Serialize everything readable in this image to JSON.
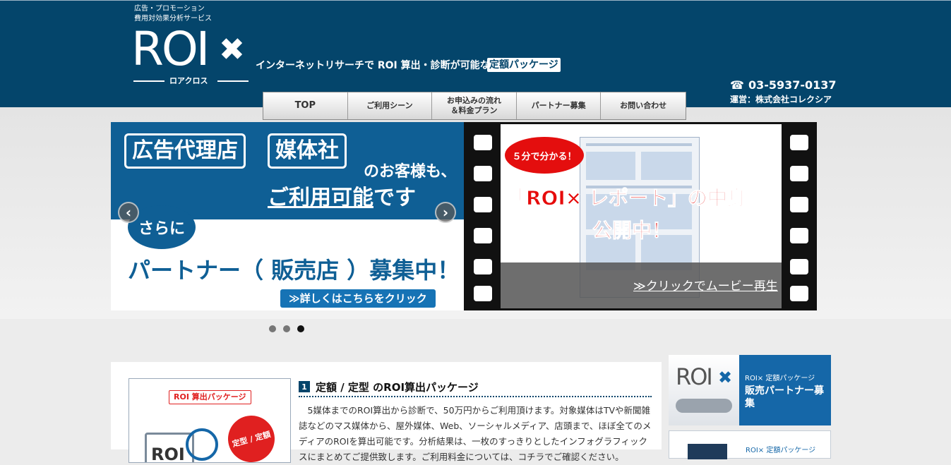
{
  "header": {
    "tagline_line1": "広告・プロモーション",
    "tagline_line2": "費用対効果分析サービス",
    "logo_text": "ROI",
    "logo_x": "✖",
    "logo_sub": "ロアクロス",
    "catchphrase": "インターネットリサーチで ROI 算出・診断が可能な",
    "package_tag": "定額パッケージ",
    "tel_icon": "☎",
    "tel": "03-5937-0137",
    "operator": "運営：株式会社コレクシア"
  },
  "nav": {
    "items": [
      {
        "label": "TOP"
      },
      {
        "label": "ご利用シーン"
      },
      {
        "label": "お申込みの流れ\n＆料金プラン"
      },
      {
        "label": "パートナー募集"
      },
      {
        "label": "お問い合わせ"
      }
    ]
  },
  "slider": {
    "left": {
      "box1": "広告代理店",
      "box2": "媒体社",
      "customers": "のお客様も、",
      "available_main": "ご利用可能",
      "available_suffix": "です",
      "bubble": "さらに",
      "partner": "パートナー（ 販売店 ）募集中！",
      "detail_button": "≫詳しくはこちらをクリック",
      "prev": "‹",
      "next": "›"
    },
    "right": {
      "bubble": "５分で分かる！",
      "headline1": "「ROI× レポート」の中身",
      "headline2": "公開中！",
      "movie_link": "≫クリックでムービー再生"
    },
    "dots": [
      {
        "active": false
      },
      {
        "active": false
      },
      {
        "active": true
      }
    ]
  },
  "main": {
    "thumb_tag": "ROI 算出パッケージ",
    "thumb_badge": "定型 / 定額",
    "thumb_logo": "ROI",
    "section_num": "1",
    "section_title": "定額 / 定型 のROI算出パッケージ",
    "paragraph": "　5媒体までのROI算出から診断で、50万円からご利用頂けます。対象媒体はTVや新聞雑誌などのマス媒体から、屋外媒体、Web、ソーシャルメディア、店頭まで、ほぼ全てのメディアのROIを算出可能です。分析結果は、一枚のすっきりとしたインフォグラフィックスにまとめてご提供致します。ご利用料金については、コチラでご確認ください。"
  },
  "sidebar": {
    "banner1_logo": "ROI",
    "banner1_x": "✖",
    "banner1_small": "ROI× 定額パッケージ",
    "banner1_big": "販売パートナー募集",
    "banner2_small": "ROI× 定額パッケージ"
  }
}
